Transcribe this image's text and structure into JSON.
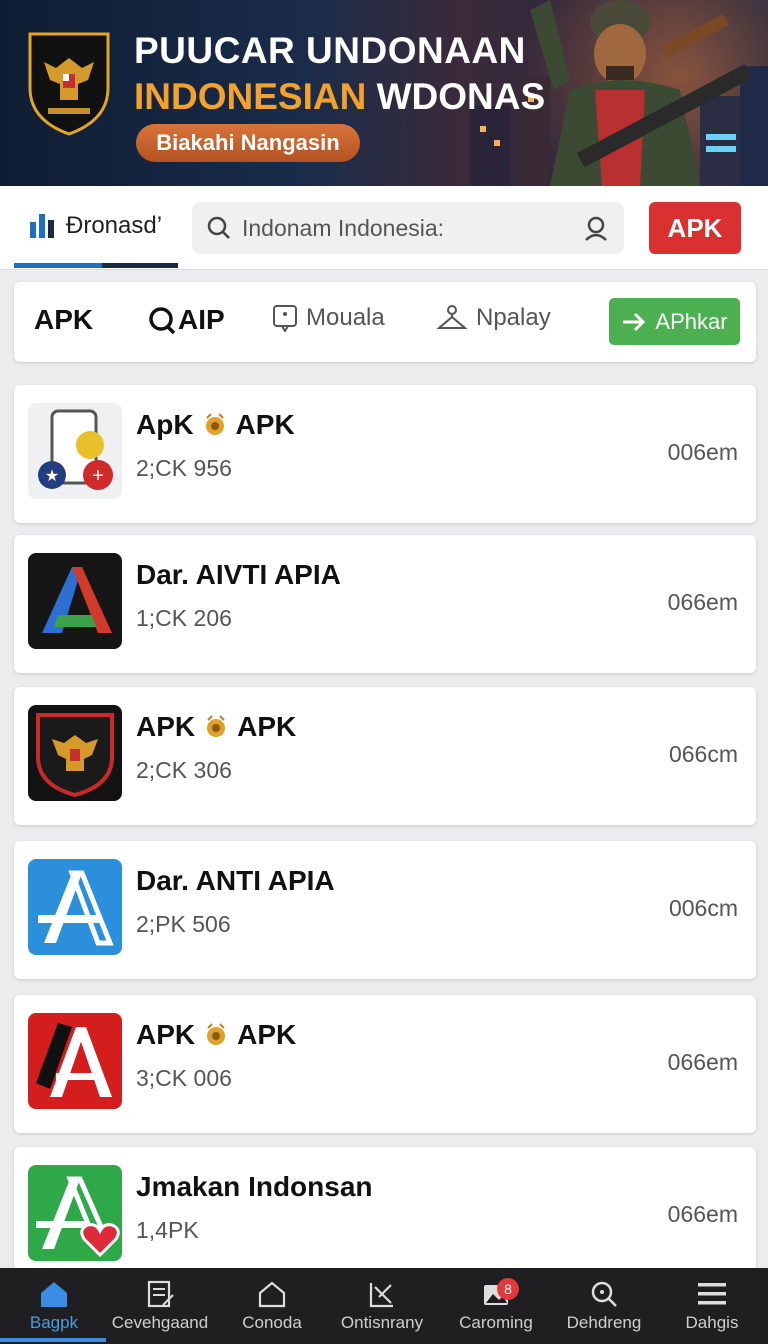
{
  "banner": {
    "title_line1": "PUUCAR UNDONAAN",
    "title_line2_a": "INDONESIAN",
    "title_line2_b": "WDONAS",
    "pill": "Biakahi Nangasin"
  },
  "header": {
    "logo_text": "Ðronasd’",
    "search_text": "Indonam Indonesia:",
    "apk_button": "APK"
  },
  "filters": {
    "apk": "APK",
    "qaip": "AIP",
    "moual": "Mouala",
    "npalay": "Npalay",
    "go": "APhkar"
  },
  "apps": [
    {
      "title_a": "ApK",
      "title_b": "APK",
      "medal": true,
      "sub": "2;CK 956",
      "size": "006em"
    },
    {
      "title_a": "Dar. AIVTI APIA",
      "title_b": "",
      "medal": false,
      "sub": "1;CK 206",
      "size": "066em"
    },
    {
      "title_a": "APK",
      "title_b": "APK",
      "medal": true,
      "sub": "2;CK 306",
      "size": "066cm"
    },
    {
      "title_a": "Dar. ANTI APIA",
      "title_b": "",
      "medal": false,
      "sub": "2;PK 506",
      "size": "006cm"
    },
    {
      "title_a": "APK",
      "title_b": "APK",
      "medal": true,
      "sub": "3;CK 006",
      "size": "066em"
    },
    {
      "title_a": "Jmakan Indonsan",
      "title_b": "",
      "medal": false,
      "sub": "1,4PK",
      "size": "066em"
    }
  ],
  "nav": {
    "items": [
      "Bagpk",
      "Cevehgaand",
      "Conoda",
      "Ontisnrany",
      "Caroming",
      "Dehdreng",
      "Dahgis"
    ],
    "badge": "8"
  },
  "colors": {
    "accent_blue": "#1d6fc4",
    "apk_red": "#d93030",
    "go_green": "#4caf50",
    "banner_orange": "#f3a22b"
  }
}
